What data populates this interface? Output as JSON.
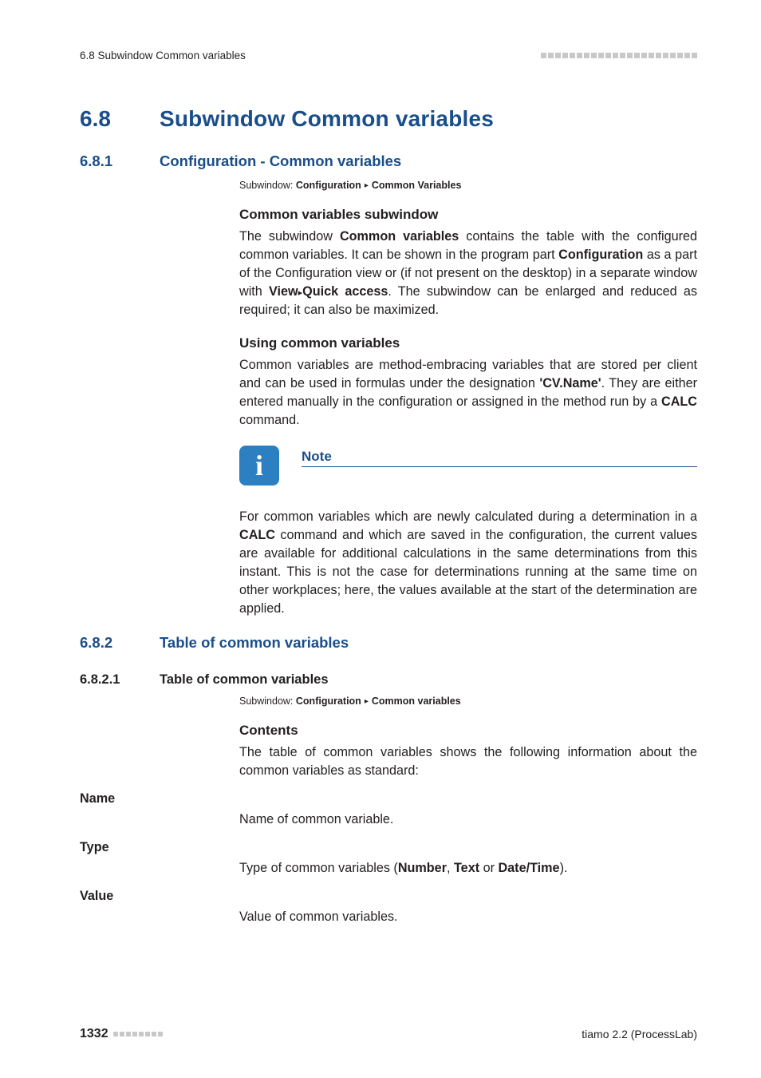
{
  "header": {
    "left": "6.8 Subwindow Common variables"
  },
  "h1": {
    "num": "6.8",
    "text": "Subwindow Common variables"
  },
  "s681": {
    "num": "6.8.1",
    "title": "Configuration - Common variables",
    "crumb_label": "Subwindow:",
    "crumb_a": "Configuration",
    "crumb_b": "Common Variables",
    "sub1_title": "Common variables subwindow",
    "sub1_p_1a": "The subwindow ",
    "sub1_p_1b": "Common variables",
    "sub1_p_1c": " contains the table with the configured common variables. It can be shown in the program part ",
    "sub1_p_1d": "Configuration",
    "sub1_p_1e": " as a part of the Configuration view or (if not present on the desktop) in a separate window with ",
    "sub1_p_1f": "View",
    "sub1_p_1g": "Quick access",
    "sub1_p_1h": ". The subwindow can be enlarged and reduced as required; it can also be maximized.",
    "sub2_title": "Using common variables",
    "sub2_p_1a": "Common variables are method-embracing variables that are stored per client and can be used in formulas under the designation ",
    "sub2_p_1b": "'CV.Name'",
    "sub2_p_1c": ". They are either entered manually in the configuration or assigned in the method run by a ",
    "sub2_p_1d": "CALC",
    "sub2_p_1e": " command.",
    "note_label": "Note",
    "note_p_a": "For common variables which are newly calculated during a determination in a ",
    "note_p_b": "CALC",
    "note_p_c": " command and which are saved in the configuration, the current values are available for additional calculations in the same determinations from this instant. This is not the case for determinations running at the same time on other workplaces; here, the values available at the start of the determination are applied."
  },
  "s682": {
    "num": "6.8.2",
    "title": "Table of common variables"
  },
  "s6821": {
    "num": "6.8.2.1",
    "title": "Table of common variables",
    "crumb_label": "Subwindow:",
    "crumb_a": "Configuration",
    "crumb_b": "Common variables",
    "contents_title": "Contents",
    "contents_p": "The table of common variables shows the following information about the common variables as standard:",
    "defs": {
      "name_term": "Name",
      "name_body": "Name of common variable.",
      "type_term": "Type",
      "type_body_a": "Type of common variables (",
      "type_body_b": "Number",
      "type_body_c": ", ",
      "type_body_d": "Text",
      "type_body_e": " or ",
      "type_body_f": "Date/Time",
      "type_body_g": ").",
      "value_term": "Value",
      "value_body": "Value of common variables."
    }
  },
  "footer": {
    "page": "1332",
    "right": "tiamo 2.2 (ProcessLab)"
  },
  "icons": {
    "info_glyph": "i",
    "triangle": "▸"
  }
}
